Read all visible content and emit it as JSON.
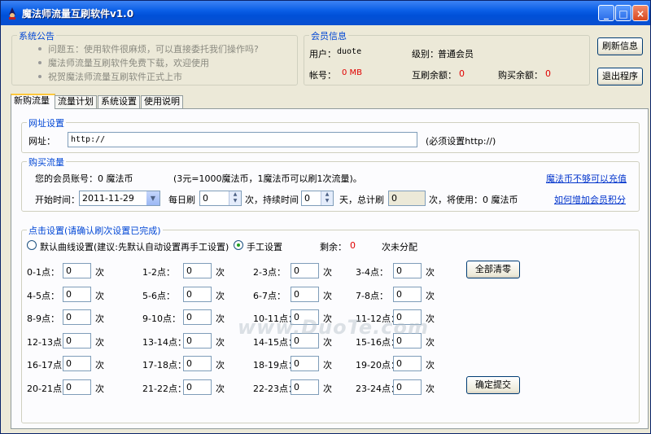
{
  "window": {
    "title": "魔法师流量互刷软件v1.0",
    "controls": [
      "_",
      "□",
      "×"
    ]
  },
  "notice": {
    "title": "系统公告",
    "items": [
      "问题五：使用软件很麻烦，可以直接委托我们操作吗?",
      "魔法师流量互刷软件免费下载，欢迎使用",
      "祝贺魔法师流量互刷软件正式上市"
    ]
  },
  "member": {
    "title": "会员信息",
    "user_label": "用户：",
    "user_value": "duote",
    "level_label": "级别：",
    "level_value": "普通会员",
    "account_label": "帐号：",
    "account_value": "0 MB",
    "balance_label": "互刷余额：",
    "balance_value": "0",
    "buy_balance_label": "购买余额：",
    "buy_balance_value": "0"
  },
  "buttons": {
    "refresh": "刷新信息",
    "exit": "退出程序",
    "clear_all": "全部清零",
    "submit": "确定提交"
  },
  "tabs": [
    "新购流量",
    "流量计划",
    "系统设置",
    "使用说明"
  ],
  "url_settings": {
    "title": "网址设置",
    "label": "网址：",
    "value": "http://",
    "hint": "(必须设置http://)"
  },
  "buy": {
    "title": "购买流量",
    "account_text": "您的会员账号：0 魔法币",
    "rate_text": "(3元=1000魔法币，1魔法币可以刷1次流量)。",
    "link_not_enough": "魔法币不够可以充值",
    "start_label": "开始时间：",
    "start_value": "2011-11-29",
    "daily_label": "每日刷",
    "daily_value": "0",
    "times_duration": "次，持续时间",
    "duration_value": "0",
    "days_total": "天，总计刷",
    "total_value": "0",
    "used_text": "次，将使用：0 魔法币",
    "link_points": "如何增加会员积分"
  },
  "click": {
    "title": "点击设置(请确认刷次设置已完成)",
    "radio_default": "默认曲线设置(建议:先默认自动设置再手工设置)",
    "radio_manual": "手工设置",
    "remaining_label": "剩余：",
    "remaining_value": "0",
    "unassigned": "次未分配",
    "unit": "次",
    "hours": [
      {
        "label": "0-1点：",
        "value": "0"
      },
      {
        "label": "1-2点：",
        "value": "0"
      },
      {
        "label": "2-3点：",
        "value": "0"
      },
      {
        "label": "3-4点：",
        "value": "0"
      },
      {
        "label": "4-5点：",
        "value": "0"
      },
      {
        "label": "5-6点：",
        "value": "0"
      },
      {
        "label": "6-7点：",
        "value": "0"
      },
      {
        "label": "7-8点：",
        "value": "0"
      },
      {
        "label": "8-9点：",
        "value": "0"
      },
      {
        "label": "9-10点：",
        "value": "0"
      },
      {
        "label": "10-11点：",
        "value": "0"
      },
      {
        "label": "11-12点：",
        "value": "0"
      },
      {
        "label": "12-13点：",
        "value": "0"
      },
      {
        "label": "13-14点：",
        "value": "0"
      },
      {
        "label": "14-15点：",
        "value": "0"
      },
      {
        "label": "15-16点：",
        "value": "0"
      },
      {
        "label": "16-17点：",
        "value": "0"
      },
      {
        "label": "17-18点：",
        "value": "0"
      },
      {
        "label": "18-19点：",
        "value": "0"
      },
      {
        "label": "19-20点：",
        "value": "0"
      },
      {
        "label": "20-21点：",
        "value": "0"
      },
      {
        "label": "21-22点：",
        "value": "0"
      },
      {
        "label": "22-23点：",
        "value": "0"
      },
      {
        "label": "23-24点：",
        "value": "0"
      }
    ]
  },
  "watermark": "www.DuoTe.com"
}
